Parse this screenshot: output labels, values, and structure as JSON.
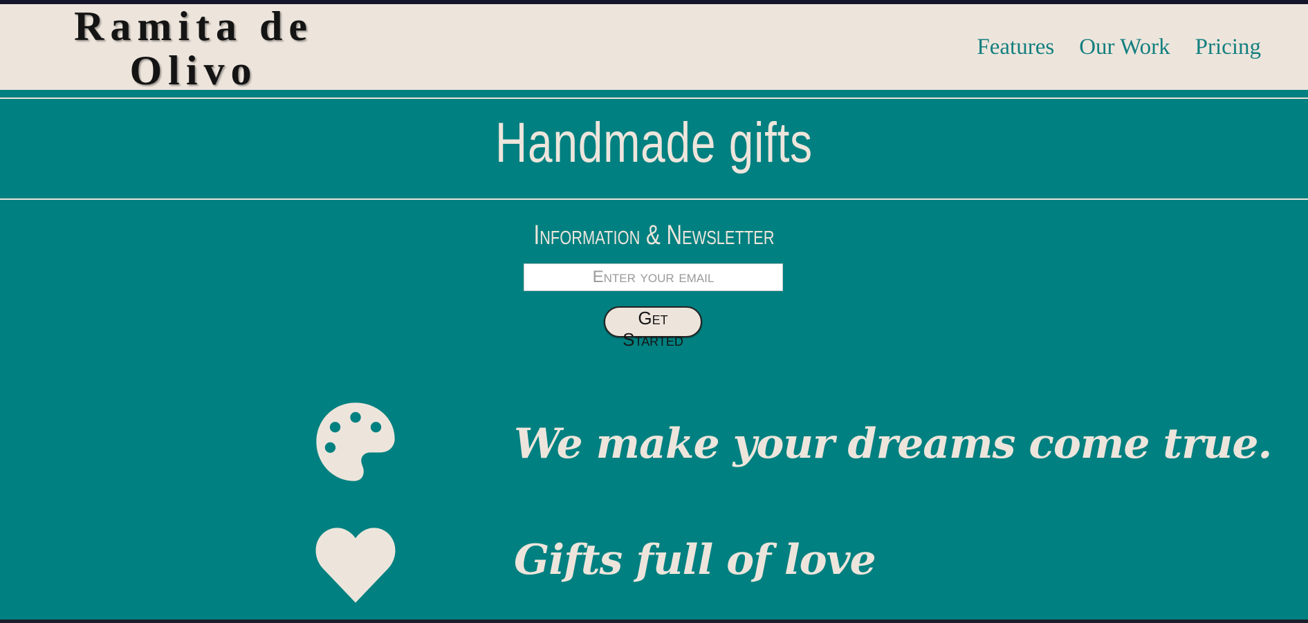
{
  "brand": {
    "line1": "Ramita de",
    "line2": "Olivo"
  },
  "nav": {
    "items": [
      {
        "label": "Features"
      },
      {
        "label": "Our Work"
      },
      {
        "label": "Pricing"
      }
    ]
  },
  "hero": {
    "title": "Handmade gifts"
  },
  "newsletter": {
    "heading": "Information & Newsletter",
    "email_placeholder": "Enter your email",
    "button_label": "Get Started"
  },
  "features": [
    {
      "icon": "palette-icon",
      "text": "We make your dreams come true."
    },
    {
      "icon": "heart-icon",
      "text": "Gifts full of love"
    }
  ],
  "colors": {
    "header_bg": "#ede5dc",
    "page_bg": "#008080",
    "nav_link": "#147f7f",
    "text_light": "#ede5dc",
    "brand_text": "#141414"
  }
}
